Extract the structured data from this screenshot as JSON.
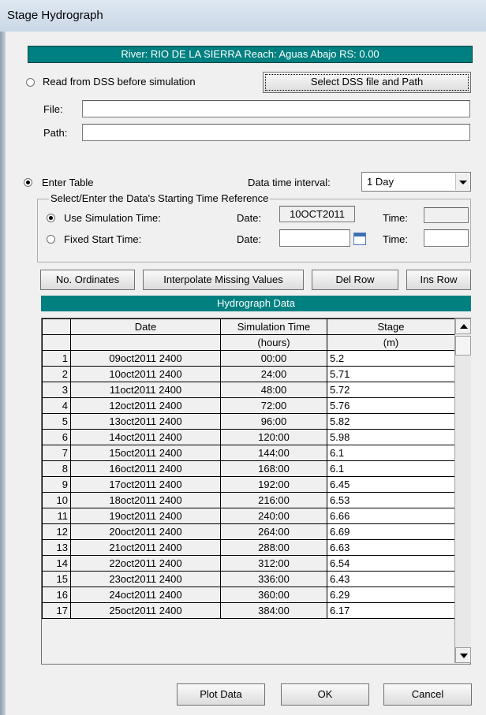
{
  "window": {
    "title": "Stage Hydrograph"
  },
  "river_bar": "River: RIO DE LA SIERRA  Reach: Aguas Abajo  RS: 0.00",
  "dss": {
    "radio_label": "Read from DSS before simulation",
    "select_button": "Select DSS file and Path",
    "file_label": "File:",
    "path_label": "Path:",
    "file_value": "",
    "path_value": ""
  },
  "enter_table": {
    "radio_label": "Enter Table",
    "interval_label": "Data time interval:",
    "interval_value": "1 Day"
  },
  "time_ref": {
    "group_label": "Select/Enter the Data's Starting Time Reference",
    "use_sim_label": "Use Simulation Time:",
    "fixed_label": "Fixed Start Time:",
    "date_label": "Date:",
    "time_label": "Time:",
    "sim_date_value": "10OCT2011",
    "sim_time_value": "",
    "fixed_date_value": "",
    "fixed_time_value": ""
  },
  "buttons": {
    "no_ordinates": "No. Ordinates",
    "interpolate": "Interpolate Missing Values",
    "del_row": "Del Row",
    "ins_row": "Ins Row",
    "plot_data": "Plot Data",
    "ok": "OK",
    "cancel": "Cancel"
  },
  "hydrograph": {
    "title": "Hydrograph Data",
    "headers": [
      "Date",
      "Simulation Time",
      "Stage"
    ],
    "units": [
      "",
      "(hours)",
      "(m)"
    ],
    "rows": [
      [
        "1",
        "09oct2011 2400",
        "00:00",
        "5.2"
      ],
      [
        "2",
        "10oct2011 2400",
        "24:00",
        "5.71"
      ],
      [
        "3",
        "11oct2011 2400",
        "48:00",
        "5.72"
      ],
      [
        "4",
        "12oct2011 2400",
        "72:00",
        "5.76"
      ],
      [
        "5",
        "13oct2011 2400",
        "96:00",
        "5.82"
      ],
      [
        "6",
        "14oct2011 2400",
        "120:00",
        "5.98"
      ],
      [
        "7",
        "15oct2011 2400",
        "144:00",
        "6.1"
      ],
      [
        "8",
        "16oct2011 2400",
        "168:00",
        "6.1"
      ],
      [
        "9",
        "17oct2011 2400",
        "192:00",
        "6.45"
      ],
      [
        "10",
        "18oct2011 2400",
        "216:00",
        "6.53"
      ],
      [
        "11",
        "19oct2011 2400",
        "240:00",
        "6.66"
      ],
      [
        "12",
        "20oct2011 2400",
        "264:00",
        "6.69"
      ],
      [
        "13",
        "21oct2011 2400",
        "288:00",
        "6.63"
      ],
      [
        "14",
        "22oct2011 2400",
        "312:00",
        "6.54"
      ],
      [
        "15",
        "23oct2011 2400",
        "336:00",
        "6.43"
      ],
      [
        "16",
        "24oct2011 2400",
        "360:00",
        "6.29"
      ],
      [
        "17",
        "25oct2011 2400",
        "384:00",
        "6.17"
      ]
    ]
  }
}
